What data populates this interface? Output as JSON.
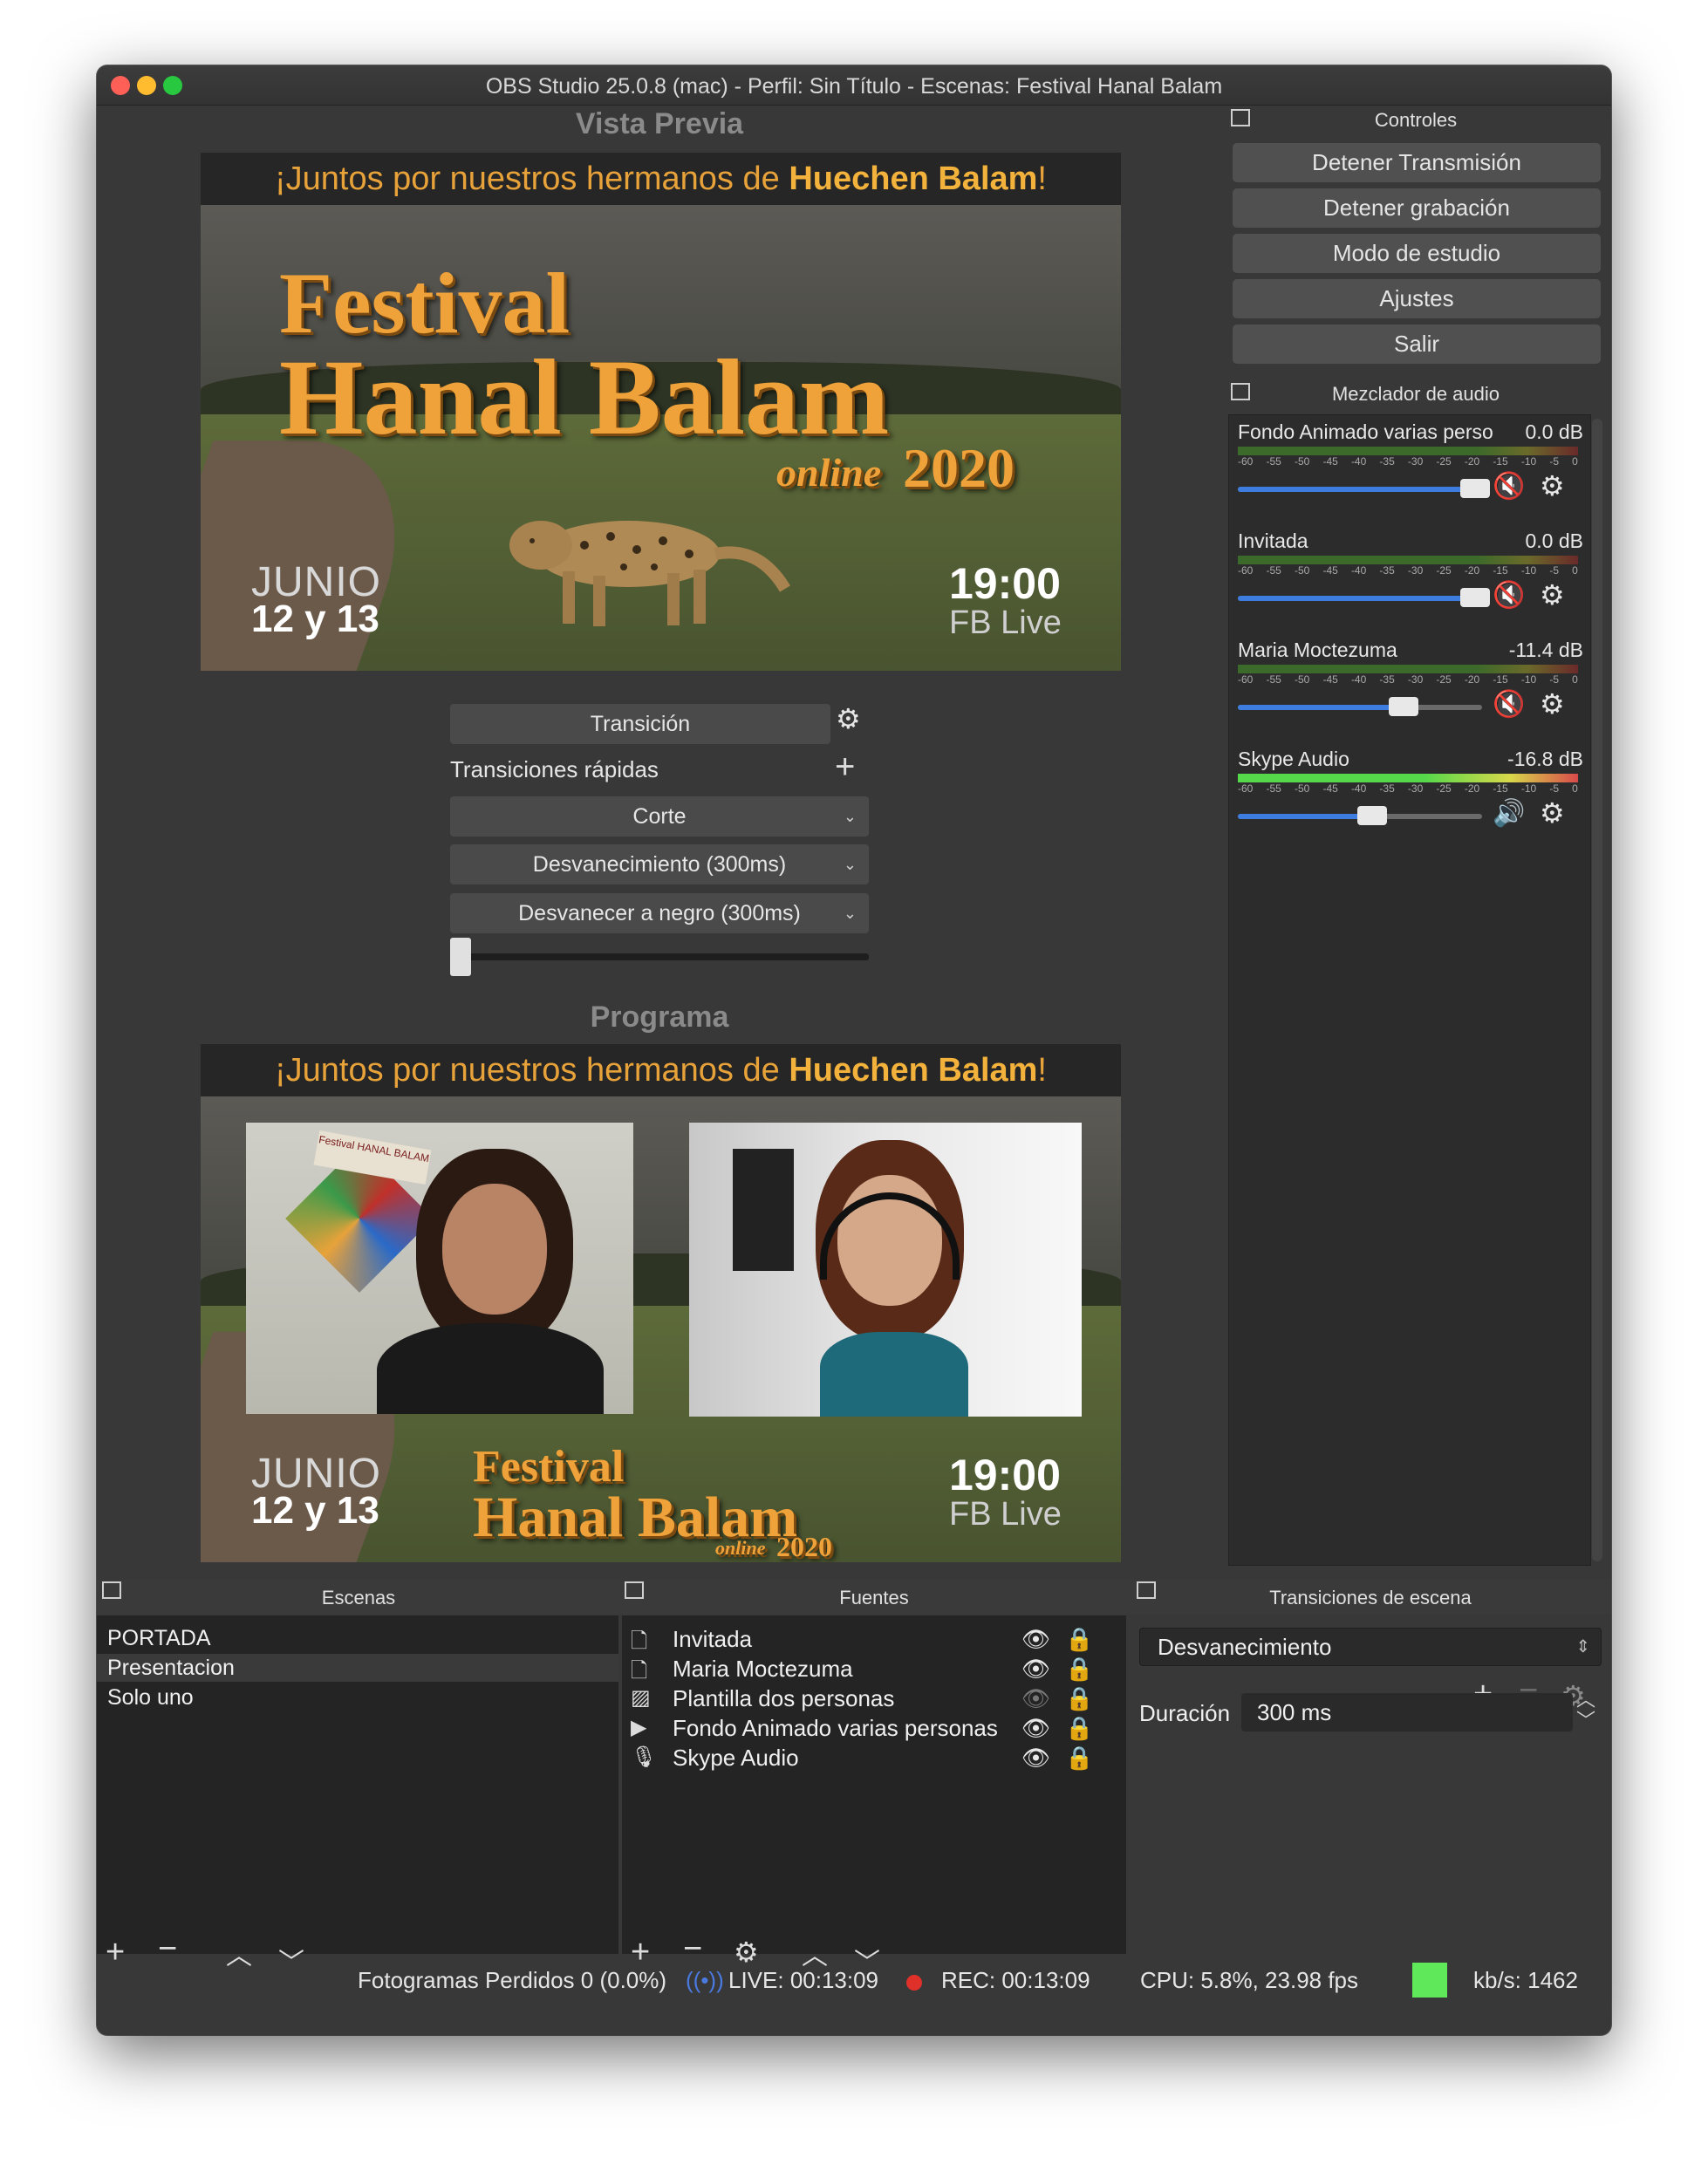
{
  "window": {
    "title": "OBS Studio 25.0.8 (mac) - Perfil: Sin Título - Escenas: Festival Hanal Balam"
  },
  "preview": {
    "title": "Vista Previa",
    "banner_pre": "¡Juntos por nuestros hermanos de ",
    "banner_bold": "Huechen Balam",
    "banner_end": "!",
    "festival": "Festival",
    "hanal": "Hanal Balam",
    "online": "online",
    "year": "2020",
    "junio": "JUNIO",
    "dates": "12 y 13",
    "time": "19:00",
    "fblive": "FB Live"
  },
  "program": {
    "title": "Programa",
    "banner_pre": "¡Juntos por nuestros hermanos de ",
    "banner_bold": "Huechen Balam",
    "banner_end": "!",
    "festival": "Festival",
    "hanal": "Hanal Balam",
    "online": "online",
    "year": "2020",
    "junio": "JUNIO",
    "dates": "12 y 13",
    "time": "19:00",
    "fblive": "FB Live",
    "poster_text": "Festival HANAL BALAM"
  },
  "transition_panel": {
    "transition": "Transición",
    "quick": "Transiciones rápidas",
    "cut": "Corte",
    "fade": "Desvanecimiento (300ms)",
    "fade_black": "Desvanecer a negro (300ms)",
    "tbar_position": 0
  },
  "controls": {
    "title": "Controles",
    "buttons": [
      "Detener Transmisión",
      "Detener grabación",
      "Modo de estudio",
      "Ajustes",
      "Salir"
    ]
  },
  "mixer": {
    "title": "Mezclador de audio",
    "ticks": [
      "-60",
      "-55",
      "-50",
      "-45",
      "-40",
      "-35",
      "-30",
      "-25",
      "-20",
      "-15",
      "-10",
      "-5",
      "0"
    ],
    "channels": [
      {
        "name": "Fondo Animado varias perso",
        "db": "0.0 dB",
        "level": 0.97,
        "muted": true
      },
      {
        "name": "Invitada",
        "db": "0.0 dB",
        "level": 0.97,
        "muted": true
      },
      {
        "name": "Maria Moctezuma",
        "db": "-11.4 dB",
        "level": 0.68,
        "muted": true
      },
      {
        "name": "Skype Audio",
        "db": "-16.8 dB",
        "level": 0.55,
        "muted": false
      }
    ]
  },
  "scenes": {
    "title": "Escenas",
    "items": [
      "PORTADA",
      "Presentacion",
      "Solo uno"
    ],
    "selected": 1
  },
  "sources": {
    "title": "Fuentes",
    "items": [
      {
        "label": "Invitada",
        "type": "file-icon",
        "visible": true,
        "locked": true
      },
      {
        "label": "Maria Moctezuma",
        "type": "file-icon",
        "visible": true,
        "locked": false
      },
      {
        "label": "Plantilla dos personas",
        "type": "image-icon",
        "visible": false,
        "locked": true
      },
      {
        "label": "Fondo Animado varias personas",
        "type": "play-icon",
        "visible": true,
        "locked": true
      },
      {
        "label": "Skype Audio",
        "type": "microphone-icon",
        "visible": true,
        "locked": true
      }
    ]
  },
  "scene_transitions": {
    "title": "Transiciones de escena",
    "selected": "Desvanecimiento",
    "duration_label": "Duración",
    "duration_value": "300 ms"
  },
  "status": {
    "dropped": "Fotogramas Perdidos 0 (0.0%)",
    "live": "LIVE: 00:13:09",
    "rec": "REC: 00:13:09",
    "cpu": "CPU: 5.8%, 23.98 fps",
    "kbs": "kb/s: 1462"
  },
  "colors": {
    "accent": "#3d7de0",
    "banner": "#f3b23b",
    "rec": "#e0302a",
    "health": "#5ee85a"
  }
}
